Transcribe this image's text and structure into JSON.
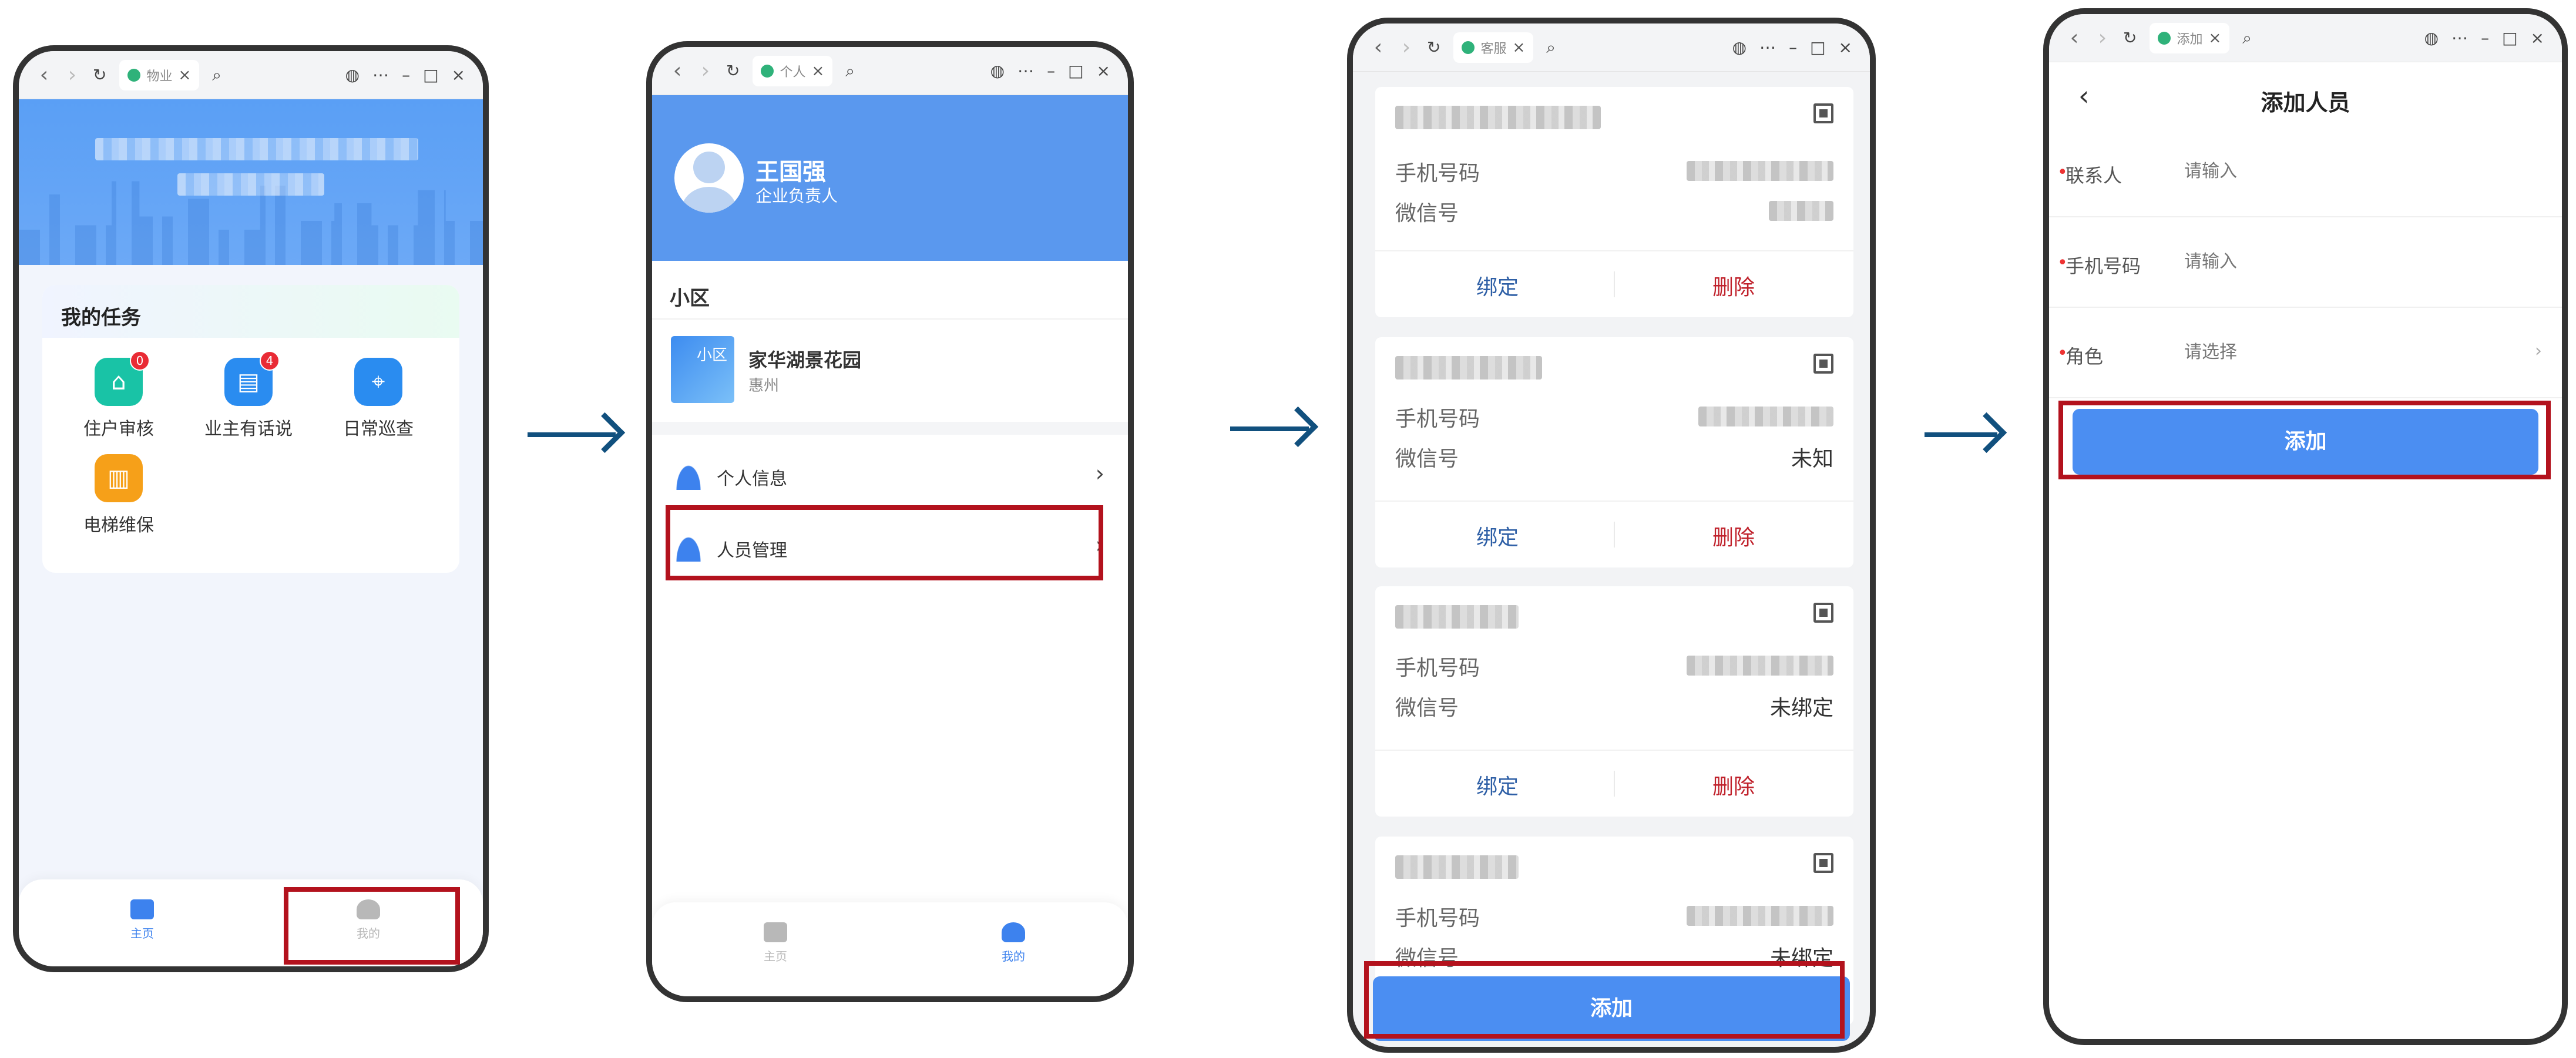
{
  "colors": {
    "primary": "#4b8ef2",
    "header": "#5a98ee",
    "arrow": "#11507e",
    "highlight": "#b3121d",
    "delete": "#c0222c",
    "bind": "#2e5fa6",
    "badge": "#e92b35"
  },
  "screen1": {
    "tab_label": "物业",
    "tasks_title": "我的任务",
    "tasks": [
      {
        "label": "住户审核",
        "badge": "0",
        "color": "#19c3a6",
        "icon": "house-check-icon"
      },
      {
        "label": "业主有话说",
        "badge": "4",
        "color": "#2a8cf0",
        "icon": "chat-icon"
      },
      {
        "label": "日常巡查",
        "badge": "",
        "color": "#2a8cf0",
        "icon": "map-pin-icon"
      },
      {
        "label": "电梯维保",
        "badge": "",
        "color": "#f6a019",
        "icon": "elevator-icon"
      }
    ],
    "tabbar": {
      "home": "主页",
      "mine": "我的"
    }
  },
  "screen2": {
    "tab_label": "个人",
    "user_name": "王国强",
    "user_role": "企业负责人",
    "section_title": "小区",
    "community_tag": "小区",
    "community_name": "家华湖景花园",
    "community_city": "惠州",
    "menu": [
      {
        "label": "个人信息",
        "icon": "person-icon"
      },
      {
        "label": "人员管理",
        "icon": "people-manage-icon"
      }
    ],
    "tabbar": {
      "home": "主页",
      "mine": "我的"
    }
  },
  "screen3": {
    "tab_label": "客服",
    "phone_label": "手机号码",
    "wechat_label": "微信号",
    "bind_label": "绑定",
    "delete_label": "删除",
    "cards": [
      {
        "wechat_value": ""
      },
      {
        "wechat_value": "未知"
      },
      {
        "wechat_value": "未绑定"
      },
      {
        "wechat_value": "未绑定"
      }
    ],
    "add_label": "添加"
  },
  "screen4": {
    "tab_label": "添加",
    "title": "添加人员",
    "fields": [
      {
        "label": "联系人",
        "placeholder": "请输入"
      },
      {
        "label": "手机号码",
        "placeholder": "请输入"
      },
      {
        "label": "角色",
        "placeholder": "请选择"
      }
    ],
    "add_label": "添加"
  }
}
